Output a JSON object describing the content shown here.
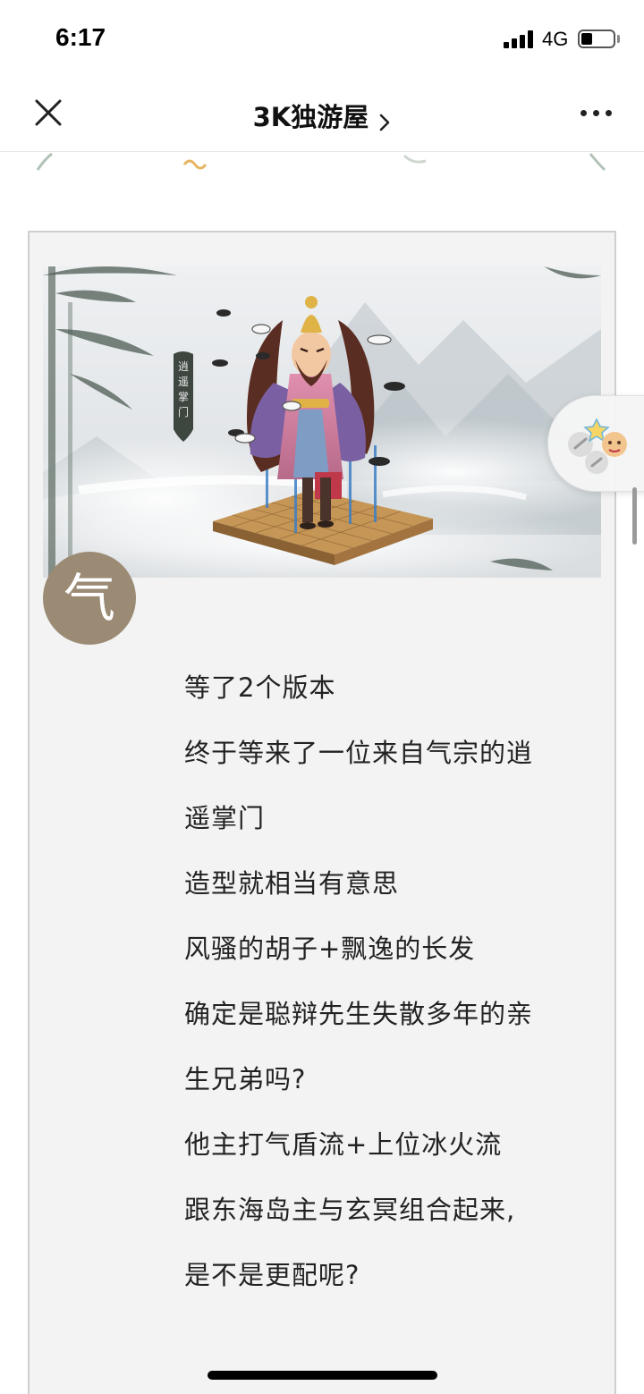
{
  "status_bar": {
    "time": "6:17",
    "network": "4G",
    "icons": [
      "signal-bars-icon",
      "battery-icon"
    ]
  },
  "nav": {
    "title": "3K独游屋",
    "icons": [
      "close-icon",
      "chevron-right-icon",
      "more-icon"
    ]
  },
  "article": {
    "banner_sign_text": "逍遥掌门",
    "badge_char": "气",
    "lines": [
      "等了2个版本",
      "终于等来了一位来自气宗的逍",
      "遥掌门",
      "造型就相当有意思",
      "风骚的胡子+飘逸的长发",
      "确定是聪辩先生失散多年的亲",
      "生兄弟吗?",
      "他主打气盾流+上位冰火流",
      "跟东海岛主与玄冥组合起来,",
      "是不是更配呢?"
    ]
  },
  "floating_bubble": {
    "icons": [
      "link-icon",
      "star-icon",
      "avatar-icon"
    ]
  },
  "colors": {
    "badge": "#9b8b75",
    "card_background": "#f3f3f3",
    "card_border": "#cfcfcf",
    "text": "#222222"
  }
}
